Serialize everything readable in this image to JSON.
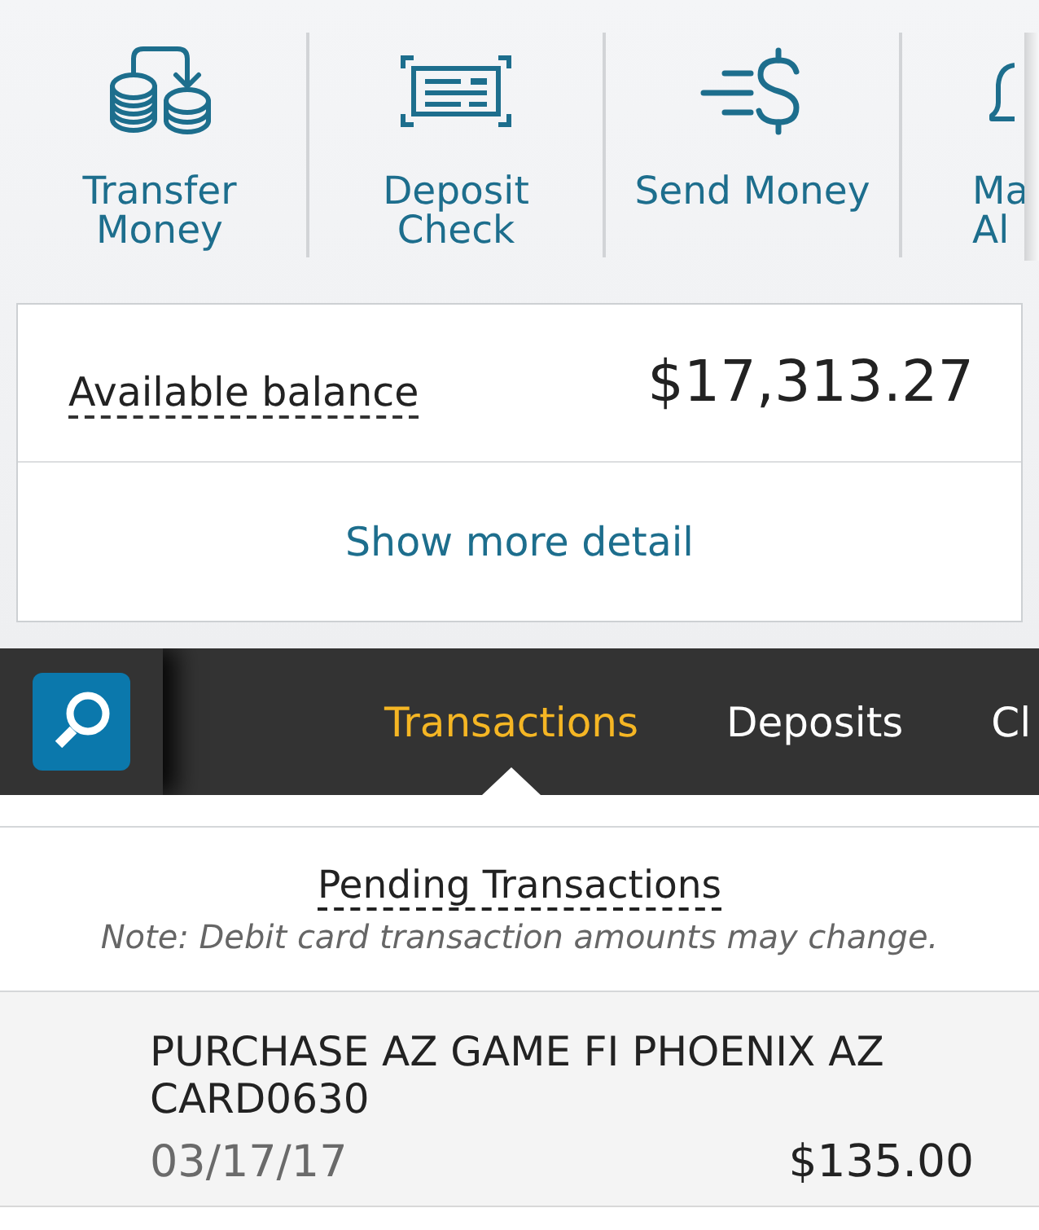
{
  "actions": [
    {
      "lines": [
        "Transfer",
        "Money"
      ]
    },
    {
      "lines": [
        "Deposit",
        "Check"
      ]
    },
    {
      "lines": [
        "Send Money"
      ]
    },
    {
      "lines": [
        "Ma",
        "Al"
      ]
    }
  ],
  "balance": {
    "label": "Available balance",
    "amount": "$17,313.27",
    "link": "Show more detail"
  },
  "nav": {
    "tabs": [
      {
        "label": "Transactions",
        "selected": true
      },
      {
        "label": "Deposits",
        "selected": false
      },
      {
        "label": "Cl",
        "selected": false
      }
    ]
  },
  "pending": {
    "title": "Pending Transactions",
    "note": "Note: Debit card transaction amounts may change."
  },
  "transactions": [
    {
      "description": "PURCHASE AZ GAME FI PHOENIX AZ CARD0630",
      "date": "03/17/17",
      "amount": "$135.00"
    }
  ]
}
